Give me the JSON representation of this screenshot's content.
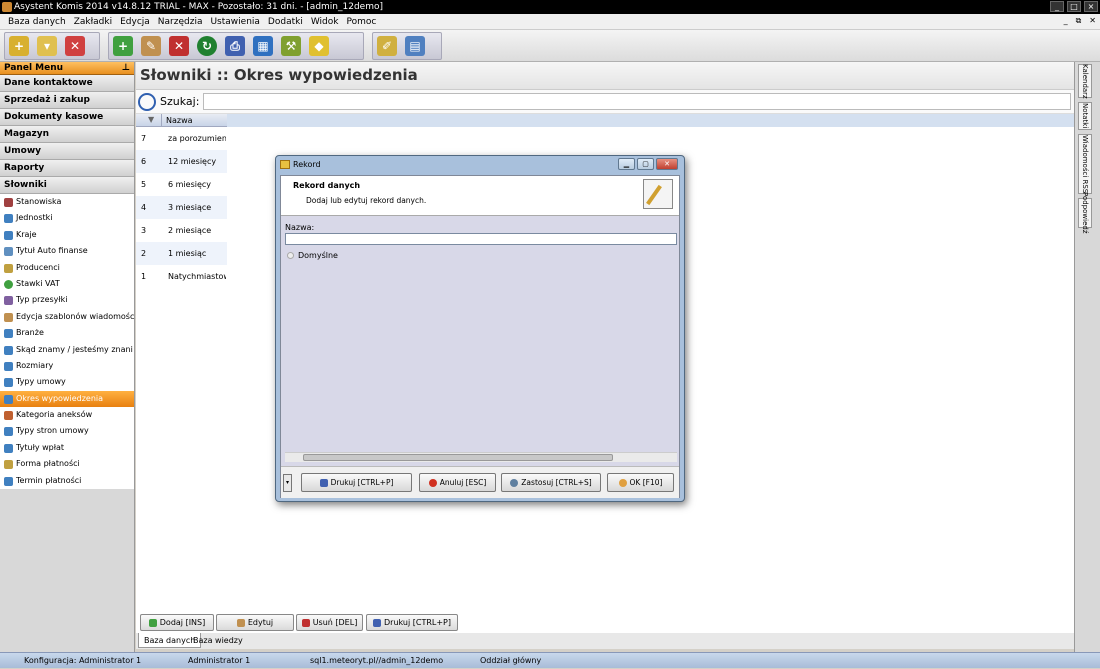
{
  "window": {
    "title": "Asystent Komis 2014 v14.8.12 TRIAL - MAX - Pozostało: 31 dni. - [admin_12demo]"
  },
  "menu": [
    "Baza danych",
    "Zakładki",
    "Edycja",
    "Narzędzia",
    "Ustawienia",
    "Dodatki",
    "Widok",
    "Pomoc"
  ],
  "panel": {
    "title": "Panel Menu",
    "categories": [
      "Dane kontaktowe",
      "Sprzedaż i zakup",
      "Dokumenty kasowe",
      "Magazyn",
      "Umowy",
      "Raporty",
      "Słowniki"
    ],
    "items": [
      "Stanowiska",
      "Jednostki",
      "Kraje",
      "Tytuł Auto finanse",
      "Producenci",
      "Stawki VAT",
      "Typ przesyłki",
      "Edycja szablonów wiadomości",
      "Branże",
      "Skąd znamy / jesteśmy znani",
      "Rozmiary",
      "Typy umowy",
      "Okres wypowiedzenia",
      "Kategoria aneksów",
      "Typy stron umowy",
      "Tytuły wpłat",
      "Forma płatności",
      "Termin płatności"
    ],
    "active_item": "Okres wypowiedzenia"
  },
  "main": {
    "title": "Słowniki :: Okres wypowiedzenia",
    "search_label": "Szukaj:",
    "search_value": "",
    "column_header": "Nazwa",
    "rows": [
      {
        "id": "7",
        "name": "za porozumieni..."
      },
      {
        "id": "6",
        "name": "12 miesięcy"
      },
      {
        "id": "5",
        "name": "6 miesięcy"
      },
      {
        "id": "4",
        "name": "3 miesiące"
      },
      {
        "id": "3",
        "name": "2 miesiące"
      },
      {
        "id": "2",
        "name": "1 miesiąc"
      },
      {
        "id": "1",
        "name": "Natychmiastowe"
      }
    ]
  },
  "bottom_buttons": [
    "Dodaj [INS]",
    "Edytuj",
    "Usuń [DEL]",
    "Drukuj [CTRL+P]"
  ],
  "bottom_tabs": [
    "Baza danych",
    "Baza wiedzy"
  ],
  "right_dock": [
    "Kalendarz",
    "Notatki",
    "Wiadomości RSS",
    "Podpowiedź"
  ],
  "status": {
    "config": "Konfiguracja: Administrator 1",
    "user": "Administrator 1",
    "db": "sql1.meteoryt.pl//admin_12demo",
    "branch": "Oddział główny"
  },
  "dialog": {
    "title": "Rekord",
    "header_title": "Rekord danych",
    "header_subtitle": "Dodaj lub edytuj rekord danych.",
    "name_label": "Nazwa:",
    "name_value": "",
    "checkbox_label": "Domyślne",
    "buttons": {
      "print": "Drukuj [CTRL+P]",
      "cancel": "Anuluj [ESC]",
      "apply": "Zastosuj [CTRL+S]",
      "ok": "OK [F10]"
    }
  }
}
